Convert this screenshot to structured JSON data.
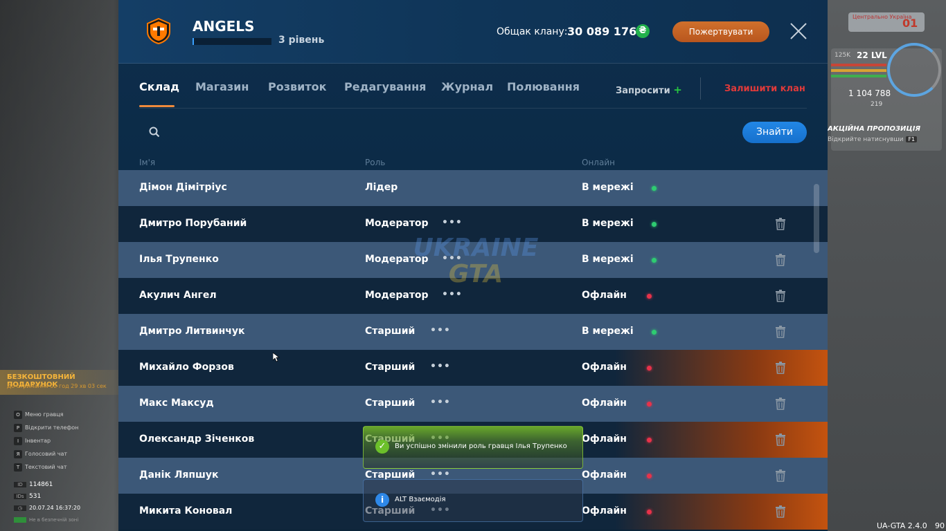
{
  "clan": {
    "name": "ANGELS",
    "level_text": "3 рівень",
    "level_progress": 0.02,
    "balance_label": "Общак клану:",
    "balance_value": "30 089 176",
    "currency_symbol": "₴",
    "donate_label": "Пожертвувати"
  },
  "tabs": [
    {
      "label": "Склад",
      "active": true
    },
    {
      "label": "Магазин"
    },
    {
      "label": "Розвиток"
    },
    {
      "label": "Редагування"
    },
    {
      "label": "Журнал"
    },
    {
      "label": "Полювання"
    }
  ],
  "actions": {
    "invite_label": "Запросити",
    "invite_plus": "+",
    "leave_label": "Залишити клан"
  },
  "search": {
    "value": "",
    "button_label": "Знайти"
  },
  "table": {
    "headers": {
      "name": "Ім'я",
      "role": "Роль",
      "online": "Онлайн"
    },
    "menu_glyph": "•••",
    "rows": [
      {
        "name": "Дімон Дімітріус",
        "role": "Лідер",
        "status": "В мережі",
        "online": true
      },
      {
        "name": "Дмитро Порубаний",
        "role": "Модератор",
        "status": "В мережі",
        "online": true
      },
      {
        "name": "Ілья Трупенко",
        "role": "Модератор",
        "status": "В мережі",
        "online": true
      },
      {
        "name": "Акулич Ангел",
        "role": "Модератор",
        "status": "Офлайн",
        "online": false
      },
      {
        "name": "Дмитро Литвинчук",
        "role": "Старший",
        "status": "В мережі",
        "online": true
      },
      {
        "name": "Михайло Форзов",
        "role": "Старший",
        "status": "Офлайн",
        "online": false
      },
      {
        "name": "Макс Максуд",
        "role": "Старший",
        "status": "Офлайн",
        "online": false
      },
      {
        "name": "Олександр Зіченков",
        "role": "Старший",
        "status": "Офлайн",
        "online": false
      },
      {
        "name": "Данік Ляпшук",
        "role": "Старший",
        "status": "Офлайн",
        "online": false
      },
      {
        "name": "Микита Коновал",
        "role": "Старший",
        "status": "Офлайн",
        "online": false
      }
    ]
  },
  "notifications": {
    "success": "Ви успішно змінили роль гравця Ілья Трупенко",
    "info": "ALT Взаємодія"
  },
  "hud": {
    "region": "Центрально Україна",
    "region_num": "01",
    "lvl_label": "125K",
    "lvl": "22 LVL",
    "money": "1 104 788",
    "coins": "219",
    "offer_title": "АКЦІЙНА ПРОПОЗИЦІЯ",
    "offer_sub": "Відкрийте натиснувши",
    "offer_key": "F1",
    "gift_title": "БЕЗКОШТОВНИЙ ПОДАРУНОК",
    "gift_sub": "До отримання 02 год 29 хв 03 сек",
    "hotkeys": [
      {
        "key": "O",
        "label": "Меню гравця"
      },
      {
        "key": "P",
        "label": "Відкрити телефон"
      },
      {
        "key": "I",
        "label": "Інвентар"
      },
      {
        "key": "Я",
        "label": "Голосовий чат"
      },
      {
        "key": "T",
        "label": "Текстовий чат"
      }
    ],
    "id_label": "ID",
    "id_value": "114861",
    "ids_label": "IDs",
    "ids_value": "531",
    "datetime": "20.07.24 16:37:20",
    "zone": "Не в безпечній зоні",
    "version": "UA-GTA 2.4.0",
    "fps": "90"
  },
  "colors": {
    "accent_orange": "#ef8a3c",
    "online_green": "#2ecc71",
    "offline_red": "#e8324a",
    "button_blue": "#1e80e0",
    "leave_red": "#e03a3a"
  }
}
